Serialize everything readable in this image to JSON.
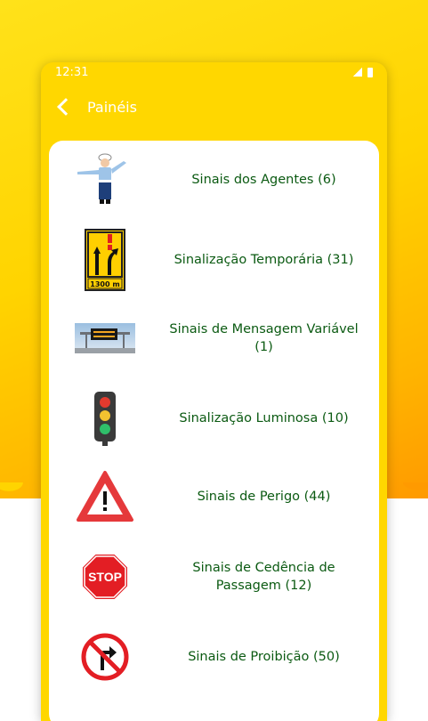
{
  "status": {
    "time": "12:31"
  },
  "header": {
    "title": "Painéis"
  },
  "items": [
    {
      "label": "Sinais dos Agentes (6)",
      "icon": "traffic-officer-icon"
    },
    {
      "label": "Sinalização Temporária (31)",
      "icon": "temporary-lane-sign-icon"
    },
    {
      "label": "Sinais de Mensagem Variável (1)",
      "icon": "variable-message-panel-icon"
    },
    {
      "label": "Sinalização Luminosa (10)",
      "icon": "traffic-light-icon"
    },
    {
      "label": "Sinais de Perigo (44)",
      "icon": "danger-triangle-icon"
    },
    {
      "label": "Sinais de Cedência de Passagem (12)",
      "icon": "stop-sign-icon"
    },
    {
      "label": "Sinais de Proibição (50)",
      "icon": "no-right-turn-icon"
    }
  ],
  "temporary_sign": {
    "distance_text": "1300 m"
  },
  "stop_sign": {
    "text": "STOP"
  },
  "colors": {
    "accent": "#ffd700",
    "label": "#0b5a12"
  }
}
